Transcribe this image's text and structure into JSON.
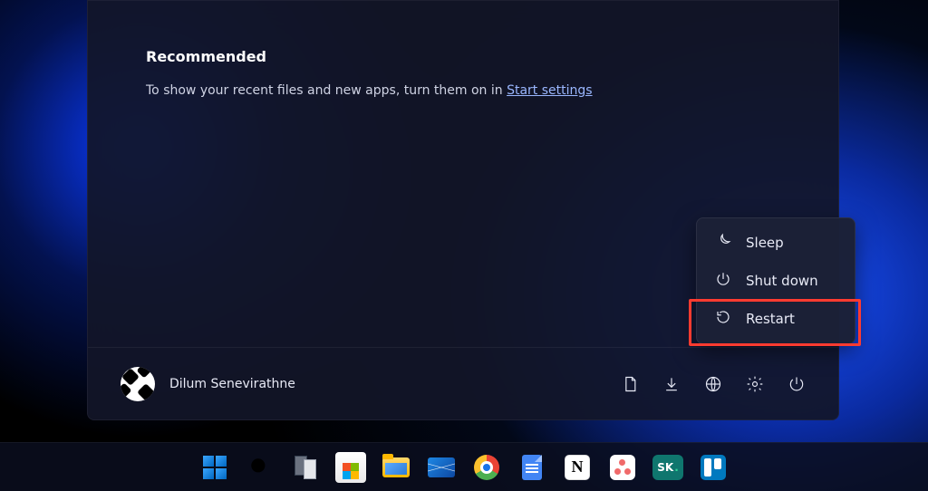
{
  "start_menu": {
    "recommended_title": "Recommended",
    "recommended_hint_prefix": "To show your recent files and new apps, turn them on in ",
    "recommended_hint_link": "Start settings",
    "user_name": "Dilum Senevirathne",
    "footer_icons": [
      "document",
      "downloads",
      "network",
      "settings",
      "power"
    ]
  },
  "power_menu": {
    "items": [
      {
        "icon": "moon",
        "label": "Sleep"
      },
      {
        "icon": "power",
        "label": "Shut down"
      },
      {
        "icon": "restart",
        "label": "Restart",
        "highlighted": true
      }
    ]
  },
  "taskbar": {
    "apps": [
      "start",
      "search",
      "task-view",
      "microsoft-store",
      "file-explorer",
      "mail",
      "chrome",
      "google-docs",
      "notion",
      "asana",
      "sk",
      "trello"
    ]
  },
  "annotation": {
    "highlight_color": "#ff3b30"
  }
}
